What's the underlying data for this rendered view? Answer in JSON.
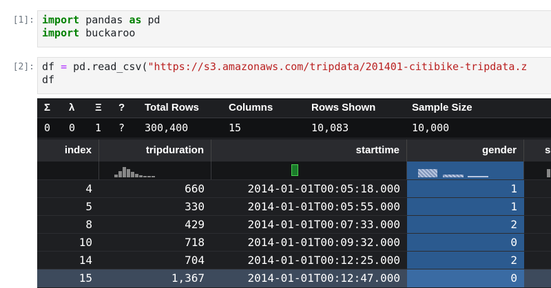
{
  "cells": [
    {
      "prompt": "[1]:",
      "lines": [
        [
          {
            "t": "import",
            "c": "kw"
          },
          {
            "t": " pandas ",
            "c": ""
          },
          {
            "t": "as",
            "c": "kw"
          },
          {
            "t": " pd",
            "c": ""
          }
        ],
        [
          {
            "t": "import",
            "c": "kw"
          },
          {
            "t": " buckaroo",
            "c": ""
          }
        ]
      ]
    },
    {
      "prompt": "[2]:",
      "lines": [
        [
          {
            "t": "df ",
            "c": ""
          },
          {
            "t": "=",
            "c": "op"
          },
          {
            "t": " pd.read_csv(",
            "c": ""
          },
          {
            "t": "\"https://s3.amazonaws.com/tripdata/201401-citibike-tripdata.z",
            "c": "str"
          }
        ],
        [
          {
            "t": "df",
            "c": ""
          }
        ]
      ]
    }
  ],
  "status": {
    "headers": [
      "Σ",
      "λ",
      "Ξ",
      "?",
      "Total Rows",
      "Columns",
      "Rows Shown",
      "Sample Size"
    ],
    "values": [
      "0",
      "0",
      "1",
      "?",
      "300,400",
      "15",
      "10,083",
      "10,000"
    ]
  },
  "table": {
    "columns": [
      "index",
      "tripduration",
      "starttime",
      "gender",
      "s"
    ],
    "rows": [
      [
        "4",
        "660",
        "2014-01-01T00:05:18.000",
        "1"
      ],
      [
        "5",
        "330",
        "2014-01-01T00:05:55.000",
        "1"
      ],
      [
        "8",
        "429",
        "2014-01-01T00:07:33.000",
        "2"
      ],
      [
        "10",
        "718",
        "2014-01-01T00:09:32.000",
        "0"
      ],
      [
        "14",
        "704",
        "2014-01-01T00:12:25.000",
        "2"
      ],
      [
        "15",
        "1,367",
        "2014-01-01T00:12:47.000",
        "0"
      ]
    ],
    "selected_row": 5
  },
  "colors": {
    "widget_bg": "#1e1f22",
    "gender_col": "#2b5a8f",
    "selected_row": "#3d4a5c",
    "keyword": "#008000",
    "string": "#ba2121"
  }
}
